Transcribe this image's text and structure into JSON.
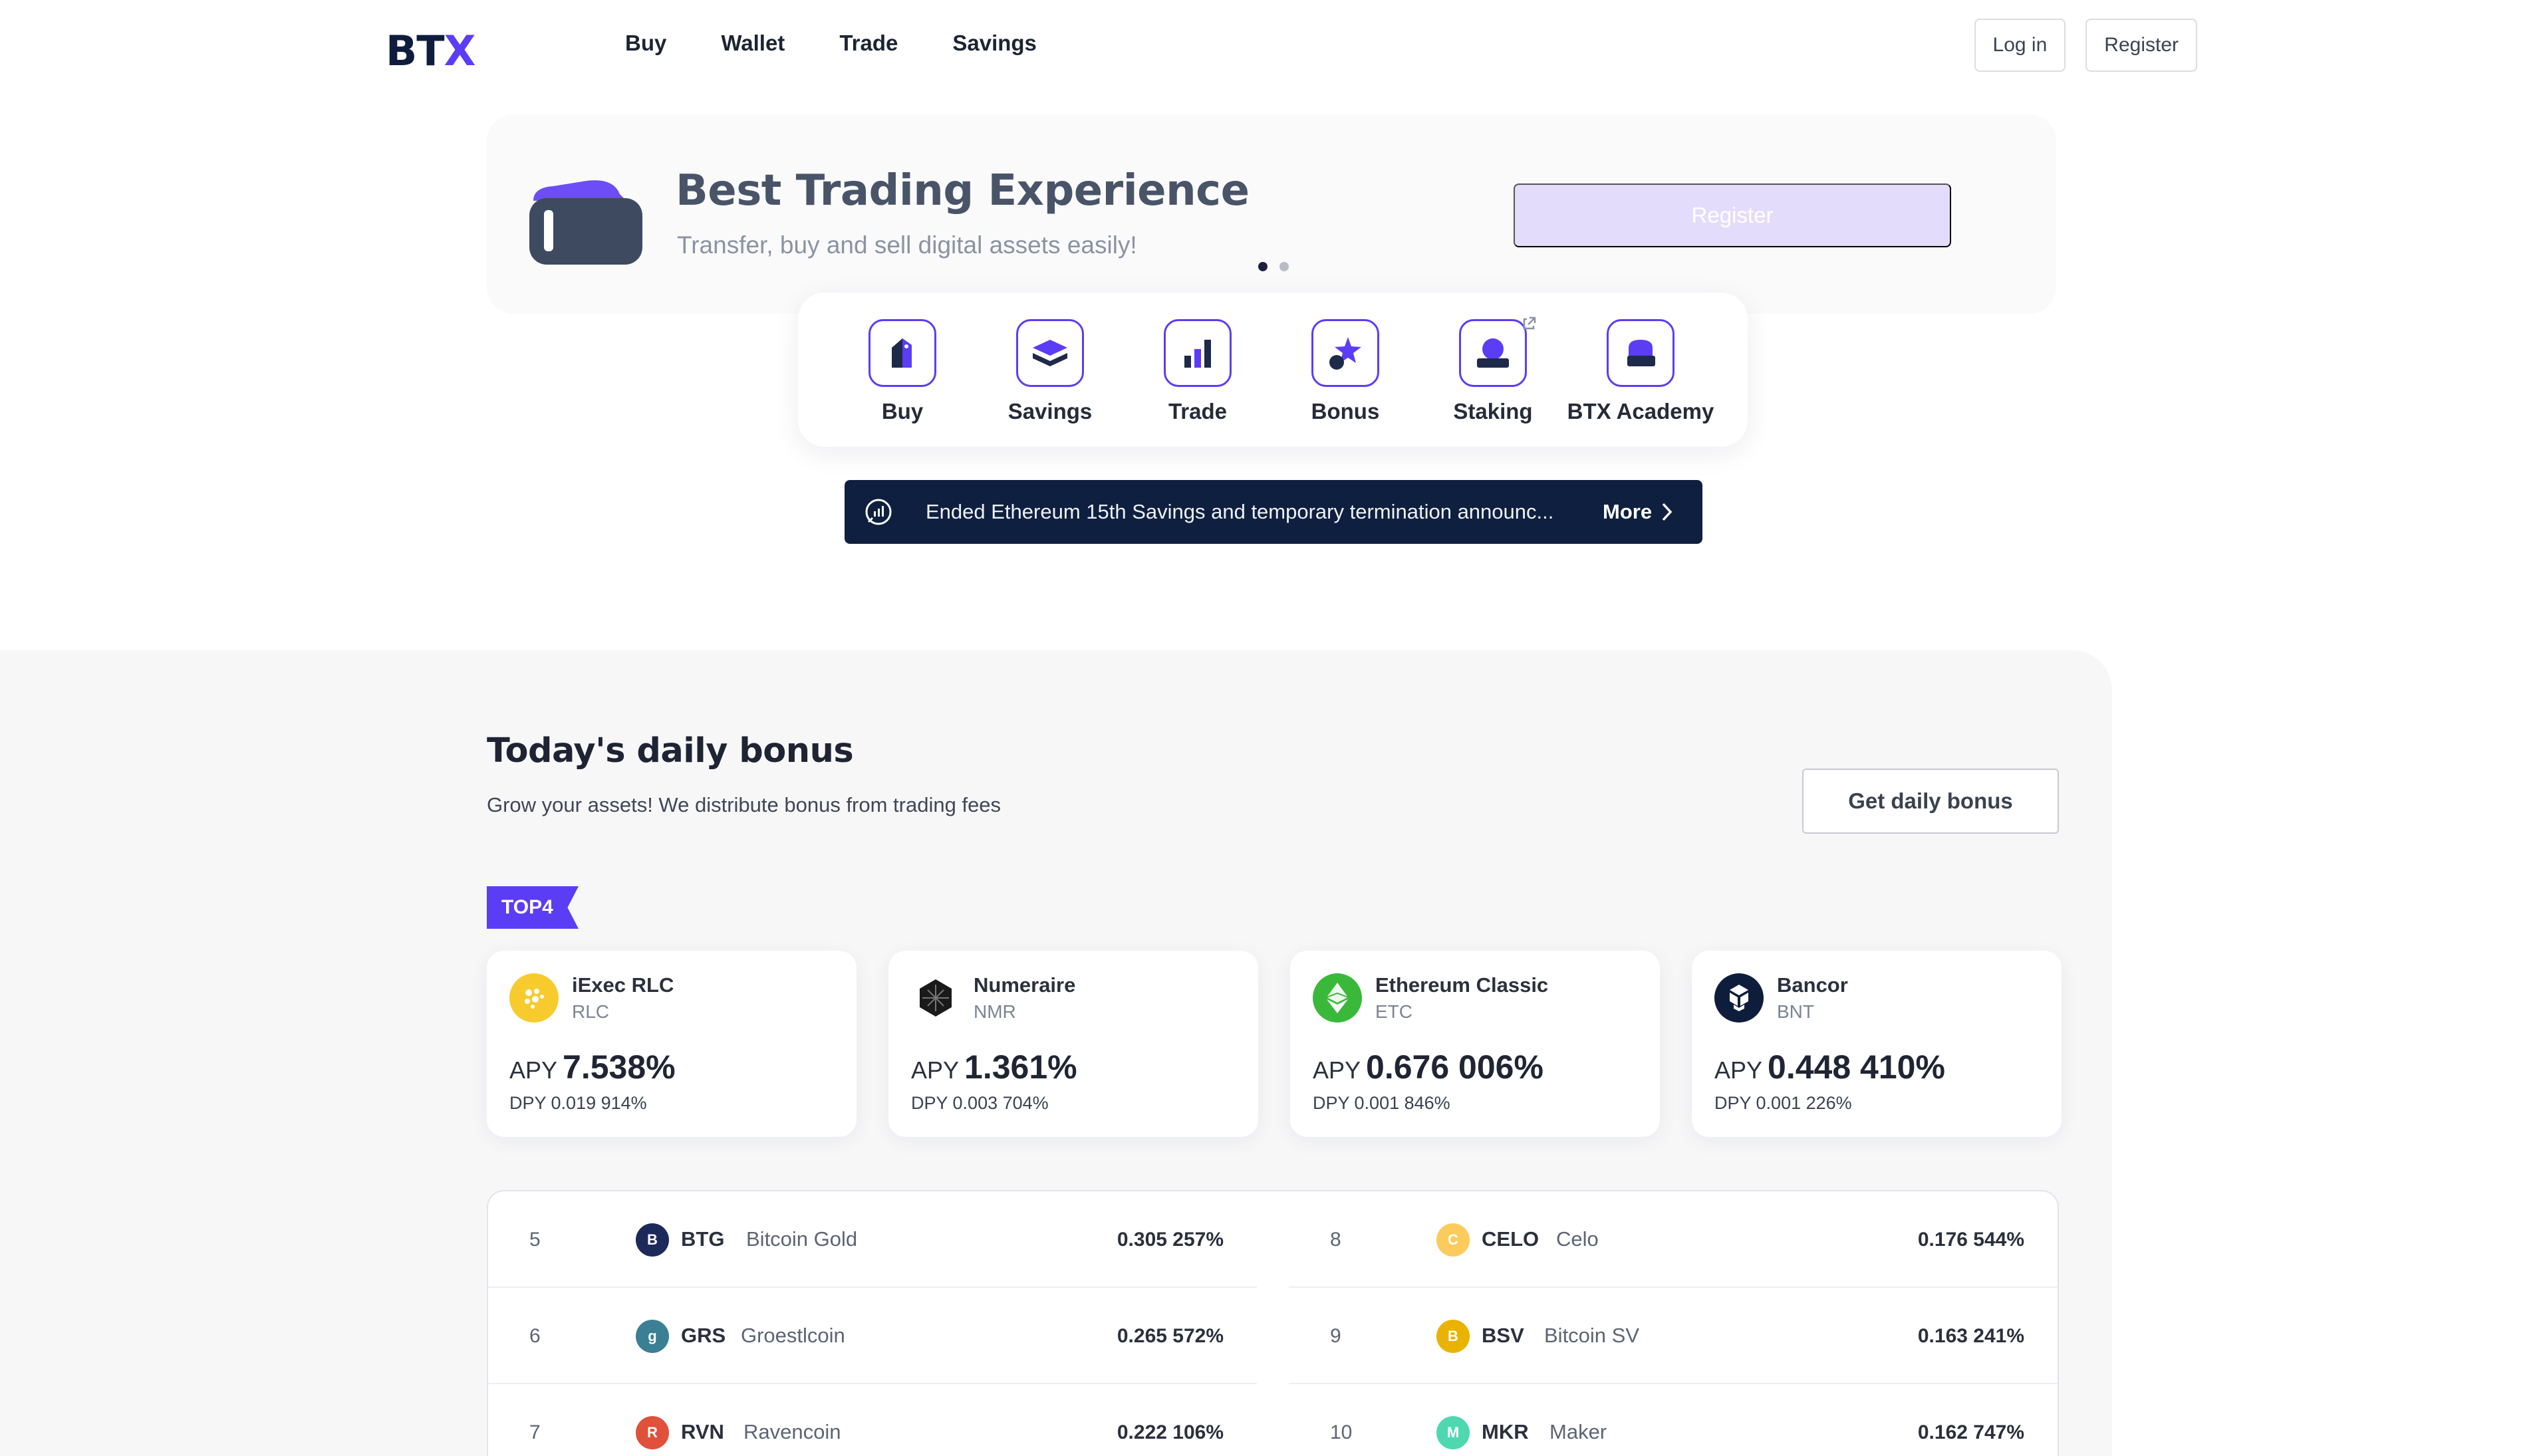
{
  "nav": {
    "logo_main": "BT",
    "logo_accent": "X",
    "links": [
      "Buy",
      "Wallet",
      "Trade",
      "Savings"
    ],
    "login": "Log in",
    "register": "Register"
  },
  "hero": {
    "title": "Best Trading Experience",
    "subtitle": "Transfer, buy and sell digital assets easily!",
    "cta": "Register",
    "slides": 2,
    "active_slide": 0
  },
  "quick_menu": [
    {
      "label": "Buy",
      "icon": "shopping-bag-icon"
    },
    {
      "label": "Savings",
      "icon": "layers-icon"
    },
    {
      "label": "Trade",
      "icon": "bar-chart-icon"
    },
    {
      "label": "Bonus",
      "icon": "star-icon"
    },
    {
      "label": "Staking",
      "icon": "stake-icon",
      "external": true
    },
    {
      "label": "BTX Academy",
      "icon": "academy-icon"
    }
  ],
  "announcement": {
    "text": "Ended Ethereum 15th Savings and temporary termination announc...",
    "more": "More"
  },
  "bonus": {
    "title": "Today's daily bonus",
    "subtitle": "Grow your assets! We distribute bonus from trading fees",
    "button": "Get daily bonus",
    "badge": "TOP4",
    "apy_label": "APY",
    "top": [
      {
        "name": "iExec RLC",
        "symbol": "RLC",
        "apy": "7.538%",
        "dpy": "DPY 0.019 914%",
        "color": "#f7cb2e"
      },
      {
        "name": "Numeraire",
        "symbol": "NMR",
        "apy": "1.361%",
        "dpy": "DPY 0.003 704%",
        "color": "#222222"
      },
      {
        "name": "Ethereum Classic",
        "symbol": "ETC",
        "apy": "0.676 006%",
        "dpy": "DPY 0.001 846%",
        "color": "#3ab83a"
      },
      {
        "name": "Bancor",
        "symbol": "BNT",
        "apy": "0.448 410%",
        "dpy": "DPY 0.001 226%",
        "color": "#0f1d3d"
      }
    ],
    "list_left": [
      {
        "rank": "5",
        "symbol": "BTG",
        "name": "Bitcoin Gold",
        "value": "0.305 257%",
        "color": "#1c2a5a"
      },
      {
        "rank": "6",
        "symbol": "GRS",
        "name": "Groestlcoin",
        "value": "0.265 572%",
        "color": "#3b7f95"
      },
      {
        "rank": "7",
        "symbol": "RVN",
        "name": "Ravencoin",
        "value": "0.222 106%",
        "color": "#e0503a"
      }
    ],
    "list_right": [
      {
        "rank": "8",
        "symbol": "CELO",
        "name": "Celo",
        "value": "0.176 544%",
        "color": "#fbcc5c"
      },
      {
        "rank": "9",
        "symbol": "BSV",
        "name": "Bitcoin SV",
        "value": "0.163 241%",
        "color": "#eab300"
      },
      {
        "rank": "10",
        "symbol": "MKR",
        "name": "Maker",
        "value": "0.162 747%",
        "color": "#4fd8b0"
      }
    ]
  }
}
